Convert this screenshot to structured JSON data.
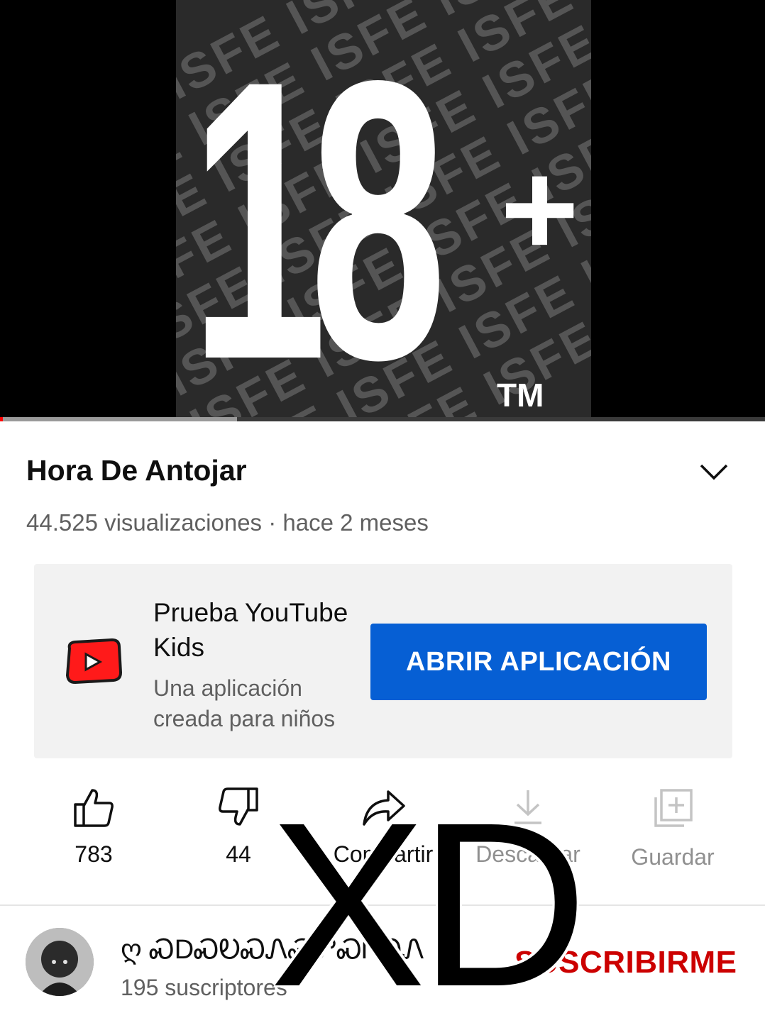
{
  "player": {
    "thumbnail": {
      "rating_text": "18",
      "plus_sign": "+",
      "trademark": "TM",
      "pattern_text": "ISFE ISFE ISFE ISFE"
    },
    "progress": {
      "buffered_fraction": 0.31,
      "played_fraction": 0.004
    }
  },
  "video": {
    "title": "Hora De Antojar",
    "meta": "44.525 visualizaciones · hace 2 meses"
  },
  "promo": {
    "title": "Prueba YouTube Kids",
    "subtitle": "Una aplicación creada para niños",
    "button_label": "ABRIR APLICACIÓN",
    "icon": "youtube-kids-icon"
  },
  "actions": [
    {
      "icon": "like-icon",
      "label": "783"
    },
    {
      "icon": "dislike-icon",
      "label": "44"
    },
    {
      "icon": "share-icon",
      "label": "Compartir"
    },
    {
      "icon": "download-icon",
      "label": "Descargar"
    },
    {
      "icon": "save-icon",
      "label": "Guardar"
    }
  ],
  "channel": {
    "name": "ღ ᏍDᏍᎧᏍᏁᏍᏛᏍᎵᏍᏁ",
    "subscribers": "195 suscriptores",
    "subscribe_label": "SUSCRIBIRME"
  },
  "overlay": {
    "text": "XD"
  },
  "colors": {
    "accent_blue": "#065fd4",
    "subscribe_red": "#cc0000",
    "progress_red": "#ff0000"
  }
}
